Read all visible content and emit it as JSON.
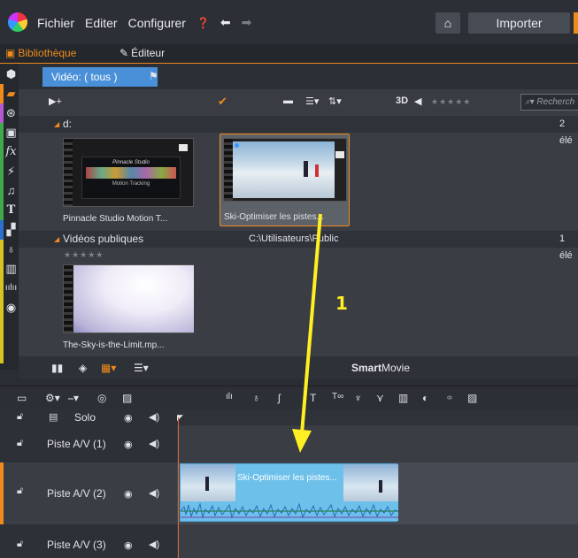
{
  "menu": {
    "items": [
      "Fichier",
      "Editer",
      "Configurer"
    ],
    "import_label": "Importer"
  },
  "tabs": {
    "library": "Bibliothèque",
    "editor": "Éditeur"
  },
  "library": {
    "view_tab": "Vidéo: ( tous )",
    "search_placeholder": "Recherch",
    "toolbar_3d": "3D",
    "groups": [
      {
        "name": "d:",
        "count": "2 élé"
      },
      {
        "name": "Vidéos publiques",
        "path": "C:\\Utilisateurs\\Public",
        "count": "1 élé"
      }
    ],
    "items": [
      {
        "label": "Pinnacle Studio Motion T...",
        "thumb_title": "Pinnacle Studio",
        "thumb_sub": "Motion Tracking"
      },
      {
        "label": "Ski-Optimiser les pistes...",
        "selected": true
      },
      {
        "label": "The-Sky-is-the-Limit.mp..."
      }
    ],
    "smartmovie_strong": "Smart",
    "smartmovie_rest": "Movie"
  },
  "timeline": {
    "solo_label": "Solo",
    "tracks": [
      {
        "label": "Piste A/V (1)"
      },
      {
        "label": "Piste A/V (2)"
      },
      {
        "label": "Piste A/V (3)"
      }
    ],
    "clip_title": "Ski-Optimiser les pistes..."
  },
  "annotation": {
    "step_number": "1",
    "arrow_color": "#ffee22"
  },
  "colors": {
    "accent": "#f08a1c",
    "selection": "#4a90d9",
    "clip": "#6cc0ea",
    "playhead": "#e0652d"
  }
}
